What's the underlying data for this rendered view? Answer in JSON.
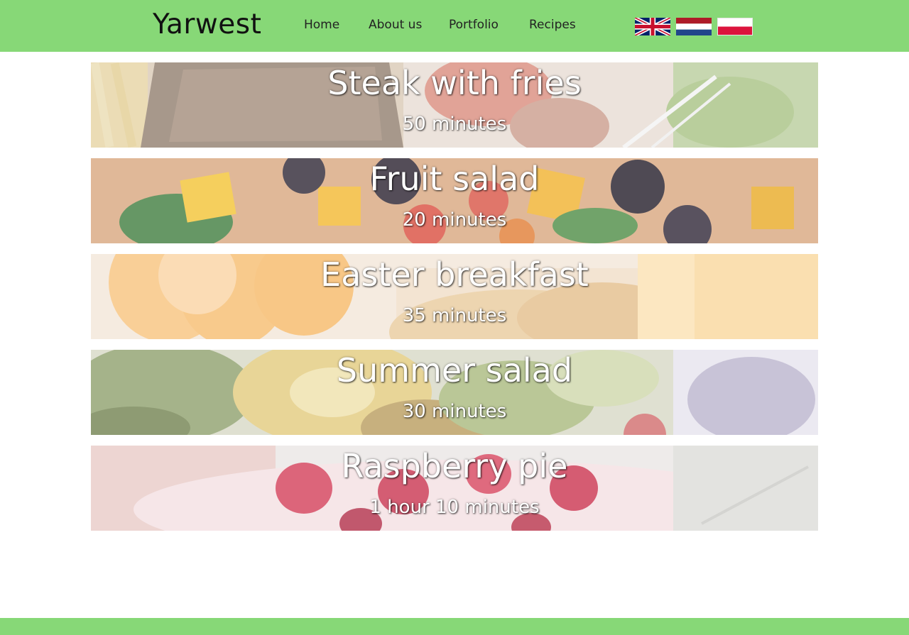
{
  "header": {
    "logo": "Yarwest",
    "nav": [
      {
        "label": "Home"
      },
      {
        "label": "About us"
      },
      {
        "label": "Portfolio"
      },
      {
        "label": "Recipes"
      }
    ],
    "languages": [
      {
        "icon": "uk-flag-icon"
      },
      {
        "icon": "netherlands-flag-icon"
      },
      {
        "icon": "poland-flag-icon"
      }
    ],
    "background_color": "#87d877"
  },
  "recipes": [
    {
      "title": "Steak with fries",
      "time": "50 minutes"
    },
    {
      "title": "Fruit salad",
      "time": "20 minutes"
    },
    {
      "title": "Easter breakfast",
      "time": "35 minutes"
    },
    {
      "title": "Summer salad",
      "time": "30 minutes"
    },
    {
      "title": "Raspberry pie",
      "time": "1 hour 10 minutes"
    }
  ],
  "footer": {
    "background_color": "#87d877"
  }
}
